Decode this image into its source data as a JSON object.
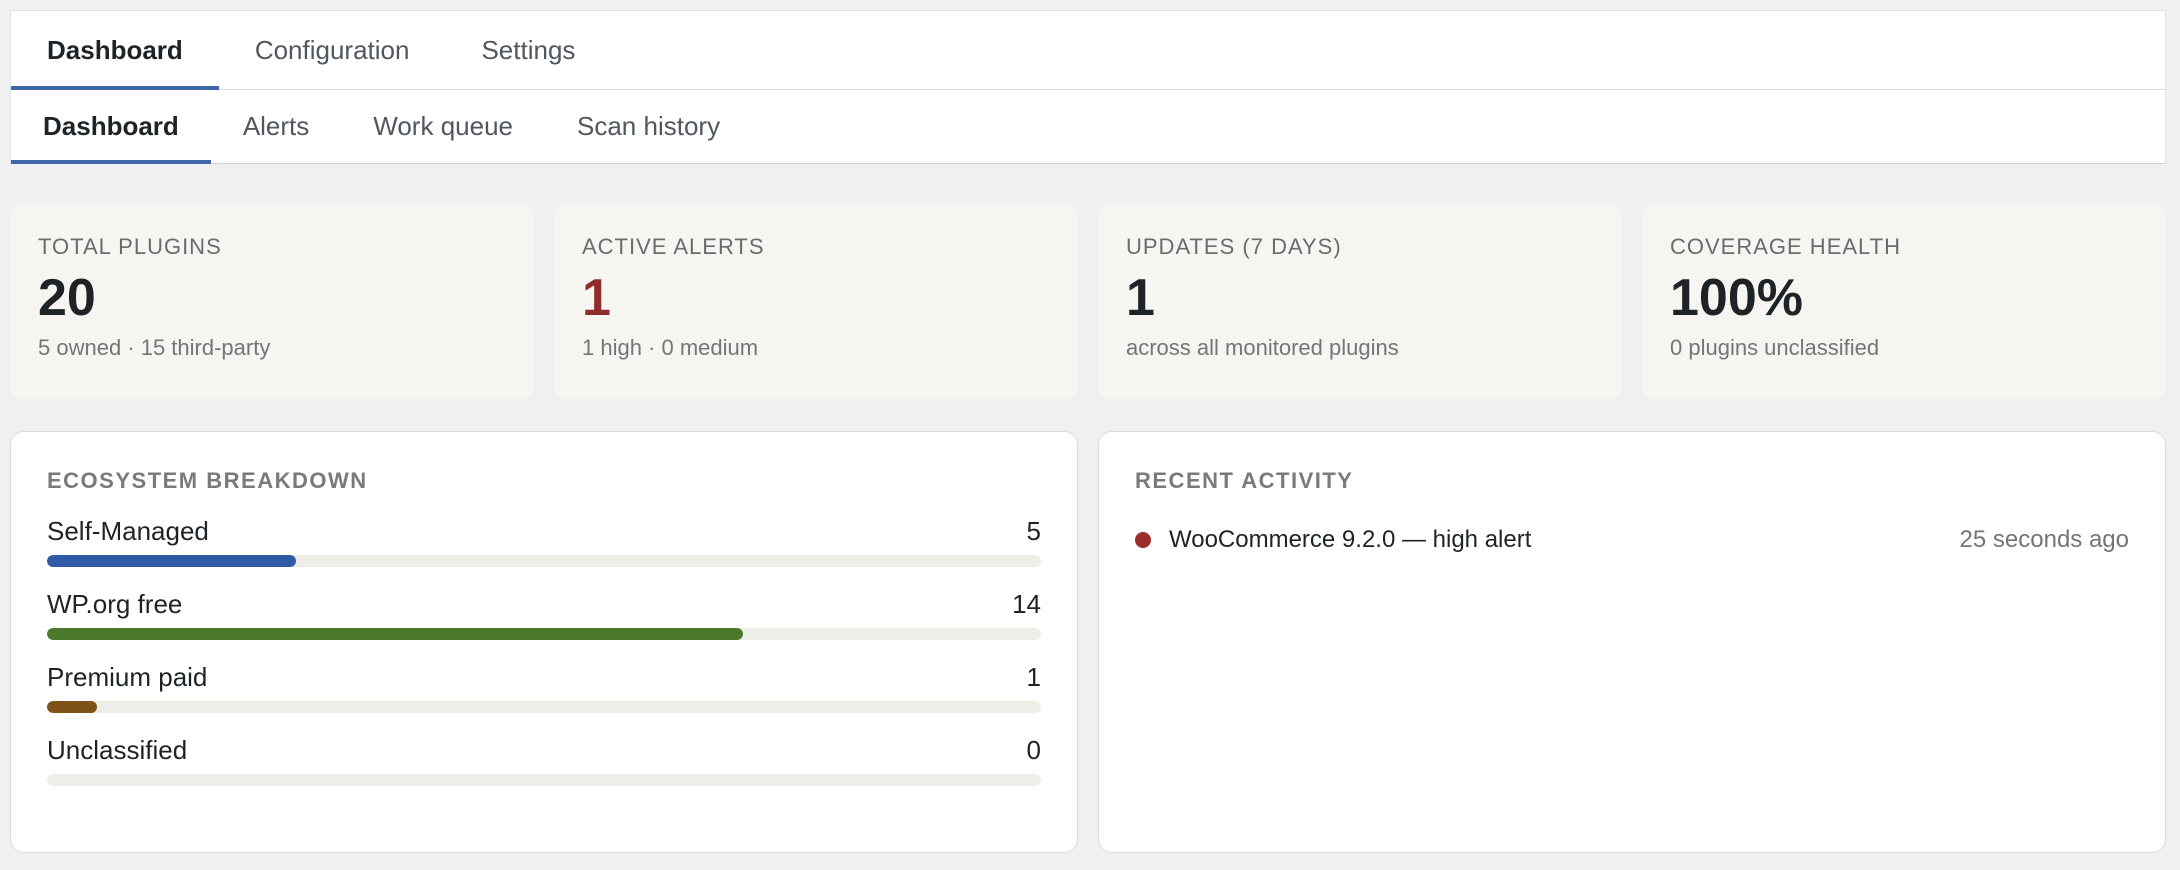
{
  "tabs_primary": [
    {
      "label": "Dashboard",
      "active": true
    },
    {
      "label": "Configuration",
      "active": false
    },
    {
      "label": "Settings",
      "active": false
    }
  ],
  "tabs_secondary": [
    {
      "label": "Dashboard",
      "active": true
    },
    {
      "label": "Alerts",
      "active": false
    },
    {
      "label": "Work queue",
      "active": false
    },
    {
      "label": "Scan history",
      "active": false
    }
  ],
  "stats": [
    {
      "label": "TOTAL PLUGINS",
      "value": "20",
      "sub": "5 owned · 15 third-party"
    },
    {
      "label": "ACTIVE ALERTS",
      "value": "1",
      "sub": "1 high · 0 medium",
      "value_color": "#8e2e2a"
    },
    {
      "label": "UPDATES (7 DAYS)",
      "value": "1",
      "sub": "across all monitored plugins"
    },
    {
      "label": "COVERAGE HEALTH",
      "value": "100%",
      "sub": "0 plugins unclassified"
    }
  ],
  "ecosystem": {
    "title": "ECOSYSTEM BREAKDOWN",
    "total": 20,
    "rows": [
      {
        "label": "Self-Managed",
        "count": "5",
        "fraction": 0.25,
        "color": "#2f5aa6"
      },
      {
        "label": "WP.org free",
        "count": "14",
        "fraction": 0.7,
        "color": "#4a7a2a"
      },
      {
        "label": "Premium paid",
        "count": "1",
        "fraction": 0.05,
        "color": "#7f5218"
      },
      {
        "label": "Unclassified",
        "count": "0",
        "fraction": 0.0,
        "color": "#999999"
      }
    ]
  },
  "activity": {
    "title": "RECENT ACTIVITY",
    "items": [
      {
        "text": "WooCommerce 9.2.0 — high alert",
        "time": "25 seconds ago",
        "dot_color": "#9b2c2c"
      }
    ]
  },
  "colors": {
    "accent": "#3f66a8",
    "alert": "#8e2e2a"
  }
}
